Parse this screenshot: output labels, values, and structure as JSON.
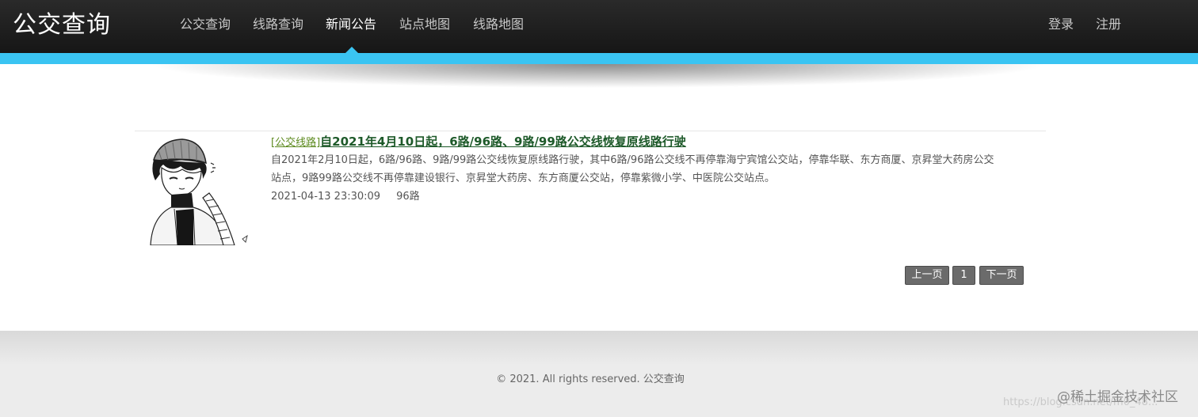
{
  "header": {
    "logo": "公交查询",
    "nav": [
      {
        "label": "公交查询"
      },
      {
        "label": "线路查询"
      },
      {
        "label": "新闻公告",
        "active": true
      },
      {
        "label": "站点地图"
      },
      {
        "label": "线路地图"
      }
    ],
    "login_label": "登录",
    "register_label": "注册"
  },
  "colors": {
    "header_bg": "#1f1f1f",
    "accent_bar": "#3ac4f2",
    "title_green": "#1e5a2a",
    "category_green": "#5c8a1e",
    "pager_bg": "#6b6b6b"
  },
  "news": [
    {
      "category": "[公交线路]",
      "title": "自2021年4月10日起，6路/96路、9路/99路公交线恢复原线路行驶",
      "summary": "自2021年2月10日起，6路/96路、9路/99路公交线恢复原线路行驶，其中6路/96路公交线不再停靠海宁宾馆公交站，停靠华联、东方商厦、京昇堂大药房公交站点，9路99路公交线不再停靠建设银行、京昇堂大药房、东方商厦公交站，停靠紫微小学、中医院公交站点。",
      "date": "2021-04-13 23:30:09",
      "tag": "96路",
      "thumbnail": "anime-boy-beanie-illustration"
    }
  ],
  "pagination": {
    "prev_label": "上一页",
    "current_page": "1",
    "next_label": "下一页"
  },
  "footer": {
    "copyright": "© 2021. All rights reserved. 公交查询",
    "watermark_url": "https://blog.csdn.net/m0_48...",
    "watermark_brand": "@稀土掘金技术社区"
  }
}
